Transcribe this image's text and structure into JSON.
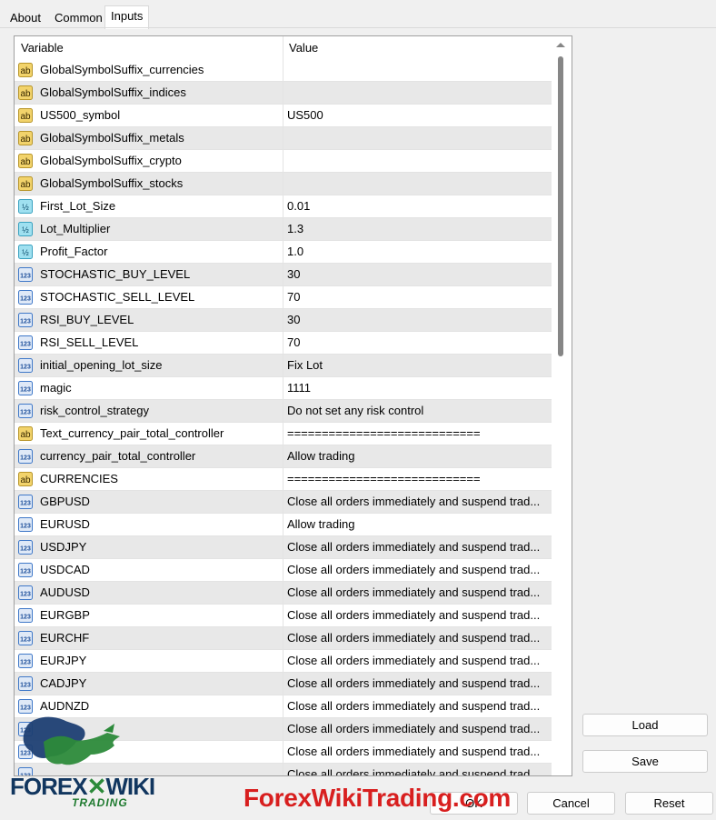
{
  "tabs": [
    "About",
    "Common",
    "Inputs"
  ],
  "active_tab": "Inputs",
  "table": {
    "columns": [
      "Variable",
      "Value"
    ],
    "rows": [
      {
        "icon": "string-icon",
        "name": "GlobalSymbolSuffix_currencies",
        "value": ""
      },
      {
        "icon": "string-icon",
        "name": "GlobalSymbolSuffix_indices",
        "value": ""
      },
      {
        "icon": "string-icon",
        "name": "US500_symbol",
        "value": "US500"
      },
      {
        "icon": "string-icon",
        "name": "GlobalSymbolSuffix_metals",
        "value": ""
      },
      {
        "icon": "string-icon",
        "name": "GlobalSymbolSuffix_crypto",
        "value": ""
      },
      {
        "icon": "string-icon",
        "name": "GlobalSymbolSuffix_stocks",
        "value": ""
      },
      {
        "icon": "double-icon",
        "name": "First_Lot_Size",
        "value": "0.01"
      },
      {
        "icon": "double-icon",
        "name": "Lot_Multiplier",
        "value": "1.3"
      },
      {
        "icon": "double-icon",
        "name": "Profit_Factor",
        "value": "1.0"
      },
      {
        "icon": "integer-icon",
        "name": "STOCHASTIC_BUY_LEVEL",
        "value": "30"
      },
      {
        "icon": "integer-icon",
        "name": "STOCHASTIC_SELL_LEVEL",
        "value": "70"
      },
      {
        "icon": "integer-icon",
        "name": "RSI_BUY_LEVEL",
        "value": "30"
      },
      {
        "icon": "integer-icon",
        "name": "RSI_SELL_LEVEL",
        "value": "70"
      },
      {
        "icon": "integer-icon",
        "name": "initial_opening_lot_size",
        "value": "Fix Lot"
      },
      {
        "icon": "integer-icon",
        "name": "magic",
        "value": "1111"
      },
      {
        "icon": "integer-icon",
        "name": "risk_control_strategy",
        "value": "Do not set any risk control"
      },
      {
        "icon": "string-icon",
        "name": "Text_currency_pair_total_controller",
        "value": "============================"
      },
      {
        "icon": "integer-icon",
        "name": "currency_pair_total_controller",
        "value": "Allow trading"
      },
      {
        "icon": "string-icon",
        "name": "CURRENCIES",
        "value": "============================"
      },
      {
        "icon": "integer-icon",
        "name": "GBPUSD",
        "value": "Close all orders immediately and suspend trad..."
      },
      {
        "icon": "integer-icon",
        "name": "EURUSD",
        "value": "Allow trading"
      },
      {
        "icon": "integer-icon",
        "name": "USDJPY",
        "value": "Close all orders immediately and suspend trad..."
      },
      {
        "icon": "integer-icon",
        "name": "USDCAD",
        "value": "Close all orders immediately and suspend trad..."
      },
      {
        "icon": "integer-icon",
        "name": "AUDUSD",
        "value": "Close all orders immediately and suspend trad..."
      },
      {
        "icon": "integer-icon",
        "name": "EURGBP",
        "value": "Close all orders immediately and suspend trad..."
      },
      {
        "icon": "integer-icon",
        "name": "EURCHF",
        "value": "Close all orders immediately and suspend trad..."
      },
      {
        "icon": "integer-icon",
        "name": "EURJPY",
        "value": "Close all orders immediately and suspend trad..."
      },
      {
        "icon": "integer-icon",
        "name": "CADJPY",
        "value": "Close all orders immediately and suspend trad..."
      },
      {
        "icon": "integer-icon",
        "name": "AUDNZD",
        "value": "Close all orders immediately and suspend trad..."
      },
      {
        "icon": "integer-icon",
        "name": "",
        "value": "Close all orders immediately and suspend trad..."
      },
      {
        "icon": "integer-icon",
        "name": "",
        "value": "Close all orders immediately and suspend trad..."
      },
      {
        "icon": "integer-icon",
        "name": "",
        "value": "Close all orders immediately and suspend trad..."
      }
    ]
  },
  "buttons": {
    "load": "Load",
    "save": "Save",
    "ok": "OK",
    "cancel": "Cancel",
    "reset": "Reset"
  },
  "watermark": {
    "site": "ForexWikiTrading.com",
    "logo_word_1": "FOREX",
    "logo_word_2": "WIKI",
    "logo_sub": "TRADING"
  },
  "colors": {
    "row_alt": "#e8e8e8",
    "string_icon": "#f2d36b",
    "double_icon": "#7fd3e8",
    "integer_icon": "#3f78c8",
    "watermark_red": "#d81f1f"
  }
}
